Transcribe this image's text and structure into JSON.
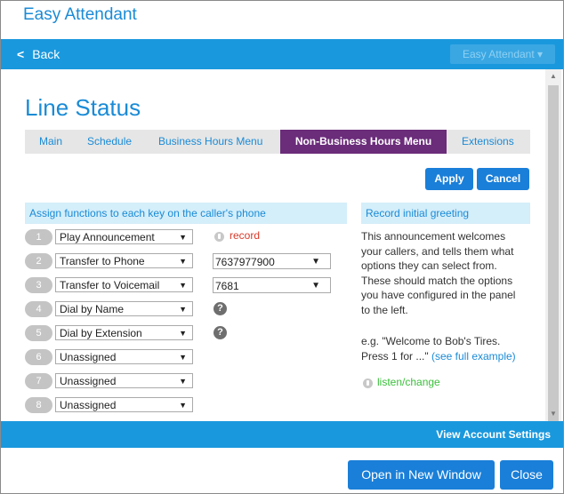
{
  "app": {
    "title": "Easy Attendant"
  },
  "topbar": {
    "back_label": "Back",
    "app_dropdown": "Easy Attendant ▾"
  },
  "page": {
    "title": "Line Status"
  },
  "tabs": [
    {
      "label": "Main"
    },
    {
      "label": "Schedule"
    },
    {
      "label": "Business Hours Menu"
    },
    {
      "label": "Non-Business Hours Menu",
      "active": true
    },
    {
      "label": "Extensions"
    }
  ],
  "actions": {
    "apply": "Apply",
    "cancel": "Cancel"
  },
  "keys_panel": {
    "header": "Assign functions to each key on the caller's phone",
    "rows": [
      {
        "key": "1",
        "function": "Play Announcement",
        "extra_type": "record",
        "extra_label": "record"
      },
      {
        "key": "2",
        "function": "Transfer to Phone",
        "extra_type": "select",
        "extra_value": "7637977900"
      },
      {
        "key": "3",
        "function": "Transfer to Voicemail",
        "extra_type": "select",
        "extra_value": "7681"
      },
      {
        "key": "4",
        "function": "Dial by Name",
        "extra_type": "help",
        "extra_label": "?"
      },
      {
        "key": "5",
        "function": "Dial by Extension",
        "extra_type": "help",
        "extra_label": "?"
      },
      {
        "key": "6",
        "function": "Unassigned"
      },
      {
        "key": "7",
        "function": "Unassigned"
      },
      {
        "key": "8",
        "function": "Unassigned"
      }
    ]
  },
  "greeting_panel": {
    "header": "Record initial greeting",
    "lines": [
      "This announcement welcomes",
      "your callers, and tells them what",
      "options they can select from.",
      "These should match the options",
      "you have configured in the panel",
      "to the left."
    ],
    "example_line1": "e.g. \"Welcome to Bob's Tires.",
    "example_line2": "Press 1 for ...\"",
    "example_link": "(see full example)",
    "listen_label": "listen/change"
  },
  "bottom_bar": {
    "link": "View Account Settings"
  },
  "footer": {
    "open_new": "Open in New Window",
    "close": "Close"
  },
  "colors": {
    "accent": "#1a98dd",
    "active_tab": "#6b2c7a",
    "record": "#d83a2a",
    "listen": "#3bbf3b"
  }
}
